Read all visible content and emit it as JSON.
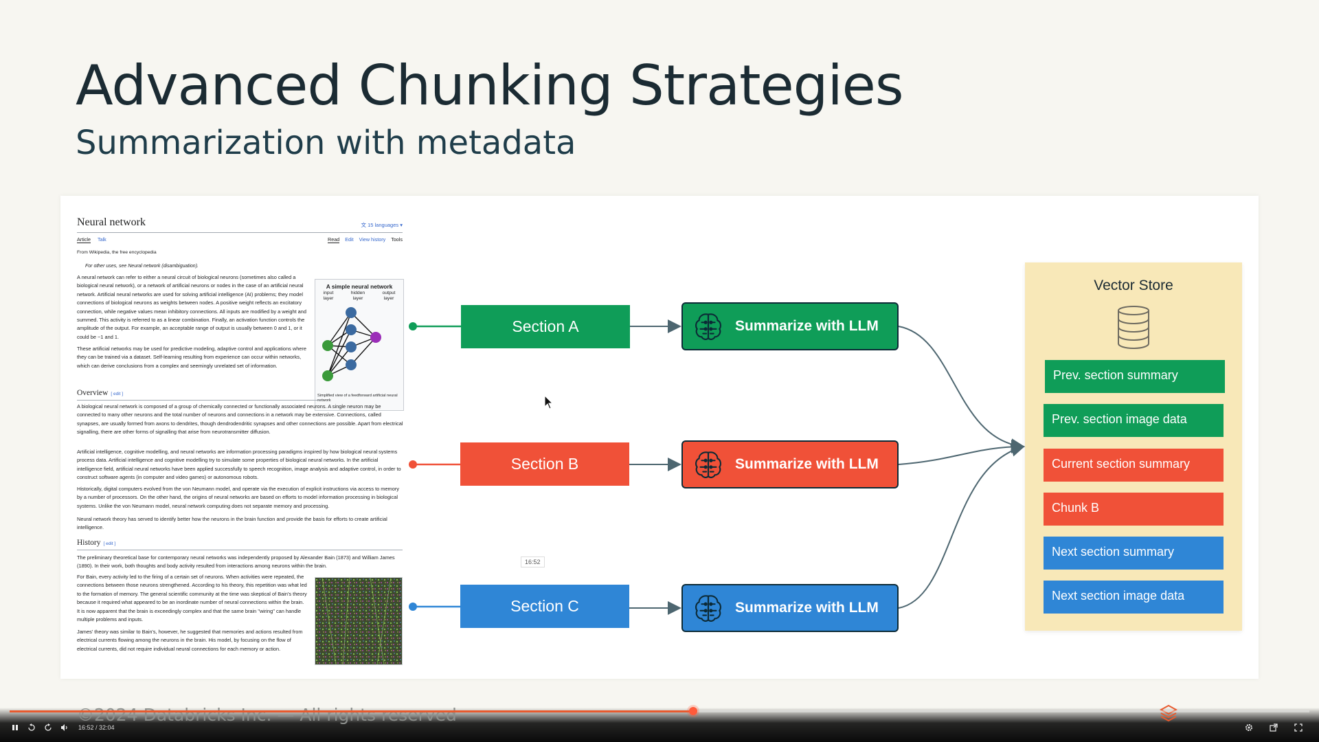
{
  "slide": {
    "title": "Advanced Chunking Strategies",
    "subtitle": "Summarization with metadata",
    "footer": "©2024 Databricks Inc. — All rights reserved"
  },
  "wiki": {
    "title": "Neural network",
    "languages": "15 languages",
    "tabs": [
      "Article",
      "Talk"
    ],
    "right_tabs": [
      "Read",
      "Edit",
      "View history",
      "Tools"
    ],
    "from": "From Wikipedia, the free encyclopedia",
    "hatnote": "For other uses, see Neural network (disambiguation).",
    "intro_1": "A neural network can refer to either a neural circuit of biological neurons (sometimes also called a biological neural network), or a network of artificial neurons or nodes in the case of an artificial neural network. Artificial neural networks are used for solving artificial intelligence (AI) problems; they model connections of biological neurons as weights between nodes. A positive weight reflects an excitatory connection, while negative values mean inhibitory connections. All inputs are modified by a weight and summed. This activity is referred to as a linear combination. Finally, an activation function controls the amplitude of the output. For example, an acceptable range of output is usually between 0 and 1, or it could be −1 and 1.",
    "intro_2": "These artificial networks may be used for predictive modeling, adaptive control and applications where they can be trained via a dataset. Self-learning resulting from experience can occur within networks, which can derive conclusions from a complex and seemingly unrelated set of information.",
    "overview_heading": "Overview",
    "edit_label": "[ edit ]",
    "overview_1": "A biological neural network is composed of a group of chemically connected or functionally associated neurons. A single neuron may be connected to many other neurons and the total number of neurons and connections in a network may be extensive. Connections, called synapses, are usually formed from axons to dendrites, though dendrodendritic synapses and other connections are possible. Apart from electrical signalling, there are other forms of signalling that arise from neurotransmitter diffusion.",
    "overview_2": "Artificial intelligence, cognitive modelling, and neural networks are information processing paradigms inspired by how biological neural systems process data. Artificial intelligence and cognitive modelling try to simulate some properties of biological neural networks. In the artificial intelligence field, artificial neural networks have been applied successfully to speech recognition, image analysis and adaptive control, in order to construct software agents (in computer and video games) or autonomous robots.",
    "overview_3": "Historically, digital computers evolved from the von Neumann model, and operate via the execution of explicit instructions via access to memory by a number of processors. On the other hand, the origins of neural networks are based on efforts to model information processing in biological systems. Unlike the von Neumann model, neural network computing does not separate memory and processing.",
    "overview_4": "Neural network theory has served to identify better how the neurons in the brain function and provide the basis for efforts to create artificial intelligence.",
    "history_heading": "History",
    "history_1": "The preliminary theoretical base for contemporary neural networks was independently proposed by Alexander Bain (1873) and William James (1890). In their work, both thoughts and body activity resulted from interactions among neurons within the brain.",
    "history_2": "For Bain, every activity led to the firing of a certain set of neurons. When activities were repeated, the connections between those neurons strengthened. According to his theory, this repetition was what led to the formation of memory. The general scientific community at the time was skeptical of Bain's theory because it required what appeared to be an inordinate number of neural connections within the brain. It is now apparent that the brain is exceedingly complex and that the same brain \"wiring\" can handle multiple problems and inputs.",
    "history_3": "James' theory was similar to Bain's, however, he suggested that memories and actions resulted from electrical currents flowing among the neurons in the brain. His model, by focusing on the flow of electrical currents, did not require individual neural connections for each memory or action.",
    "infobox_title": "A simple neural network",
    "layers": [
      "input layer",
      "hidden layer",
      "output layer"
    ],
    "infobox_caption": "Simplified view of a feedforward artificial neural network"
  },
  "diagram": {
    "sections": [
      {
        "label": "Section A",
        "color": "#0f9d58"
      },
      {
        "label": "Section B",
        "color": "#f05138"
      },
      {
        "label": "Section C",
        "color": "#2f86d6"
      }
    ],
    "summarize_label": "Summarize with LLM",
    "vector_store": {
      "title": "Vector Store",
      "items": [
        {
          "label": "Prev. section summary",
          "color": "#0f9d58"
        },
        {
          "label": "Prev. section image data",
          "color": "#0f9d58"
        },
        {
          "label": "Current section summary",
          "color": "#f05138"
        },
        {
          "label": "Chunk B",
          "color": "#f05138"
        },
        {
          "label": "Next section summary",
          "color": "#2f86d6"
        },
        {
          "label": "Next section image data",
          "color": "#2f86d6"
        }
      ]
    }
  },
  "player": {
    "tooltip": "16:52",
    "time": "16:52 / 32:04",
    "progress": 0.526
  }
}
